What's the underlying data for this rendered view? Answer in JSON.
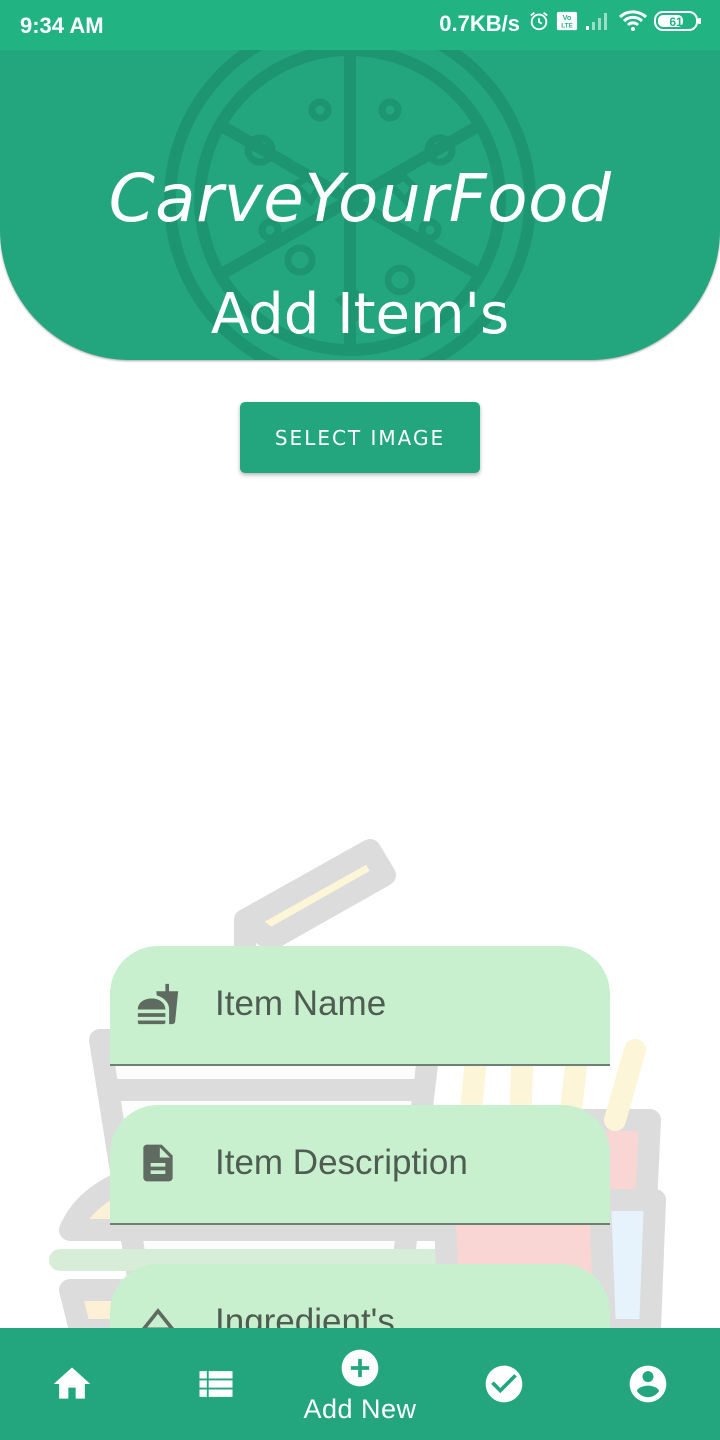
{
  "status_bar": {
    "time": "9:34 AM",
    "speed": "0.7KB/s",
    "battery": "61",
    "icons": [
      "alarm-icon",
      "volte-icon",
      "signal-icon",
      "wifi-icon",
      "battery-icon"
    ]
  },
  "header": {
    "app_title": "CarveYourFood",
    "page_title": "Add Item's",
    "background_icon": "pizza-icon"
  },
  "select_image": {
    "label": "SELECT IMAGE"
  },
  "form": {
    "fields": [
      {
        "label": "Item Name",
        "icon": "fastfood-icon"
      },
      {
        "label": "Item Description",
        "icon": "document-icon"
      },
      {
        "label": "Ingredient's",
        "icon": "ingredients-icon"
      }
    ]
  },
  "bottom_nav": {
    "items": [
      {
        "icon": "home-icon",
        "label": ""
      },
      {
        "icon": "list-icon",
        "label": ""
      },
      {
        "icon": "add-circle-icon",
        "label": "Add New"
      },
      {
        "icon": "check-circle-icon",
        "label": ""
      },
      {
        "icon": "account-icon",
        "label": ""
      }
    ],
    "active_label": "Add New"
  },
  "colors": {
    "primary": "#23a67d",
    "status_bar": "#22b382",
    "field_bg": "#c8f0cf",
    "field_text": "#4e5c52"
  }
}
